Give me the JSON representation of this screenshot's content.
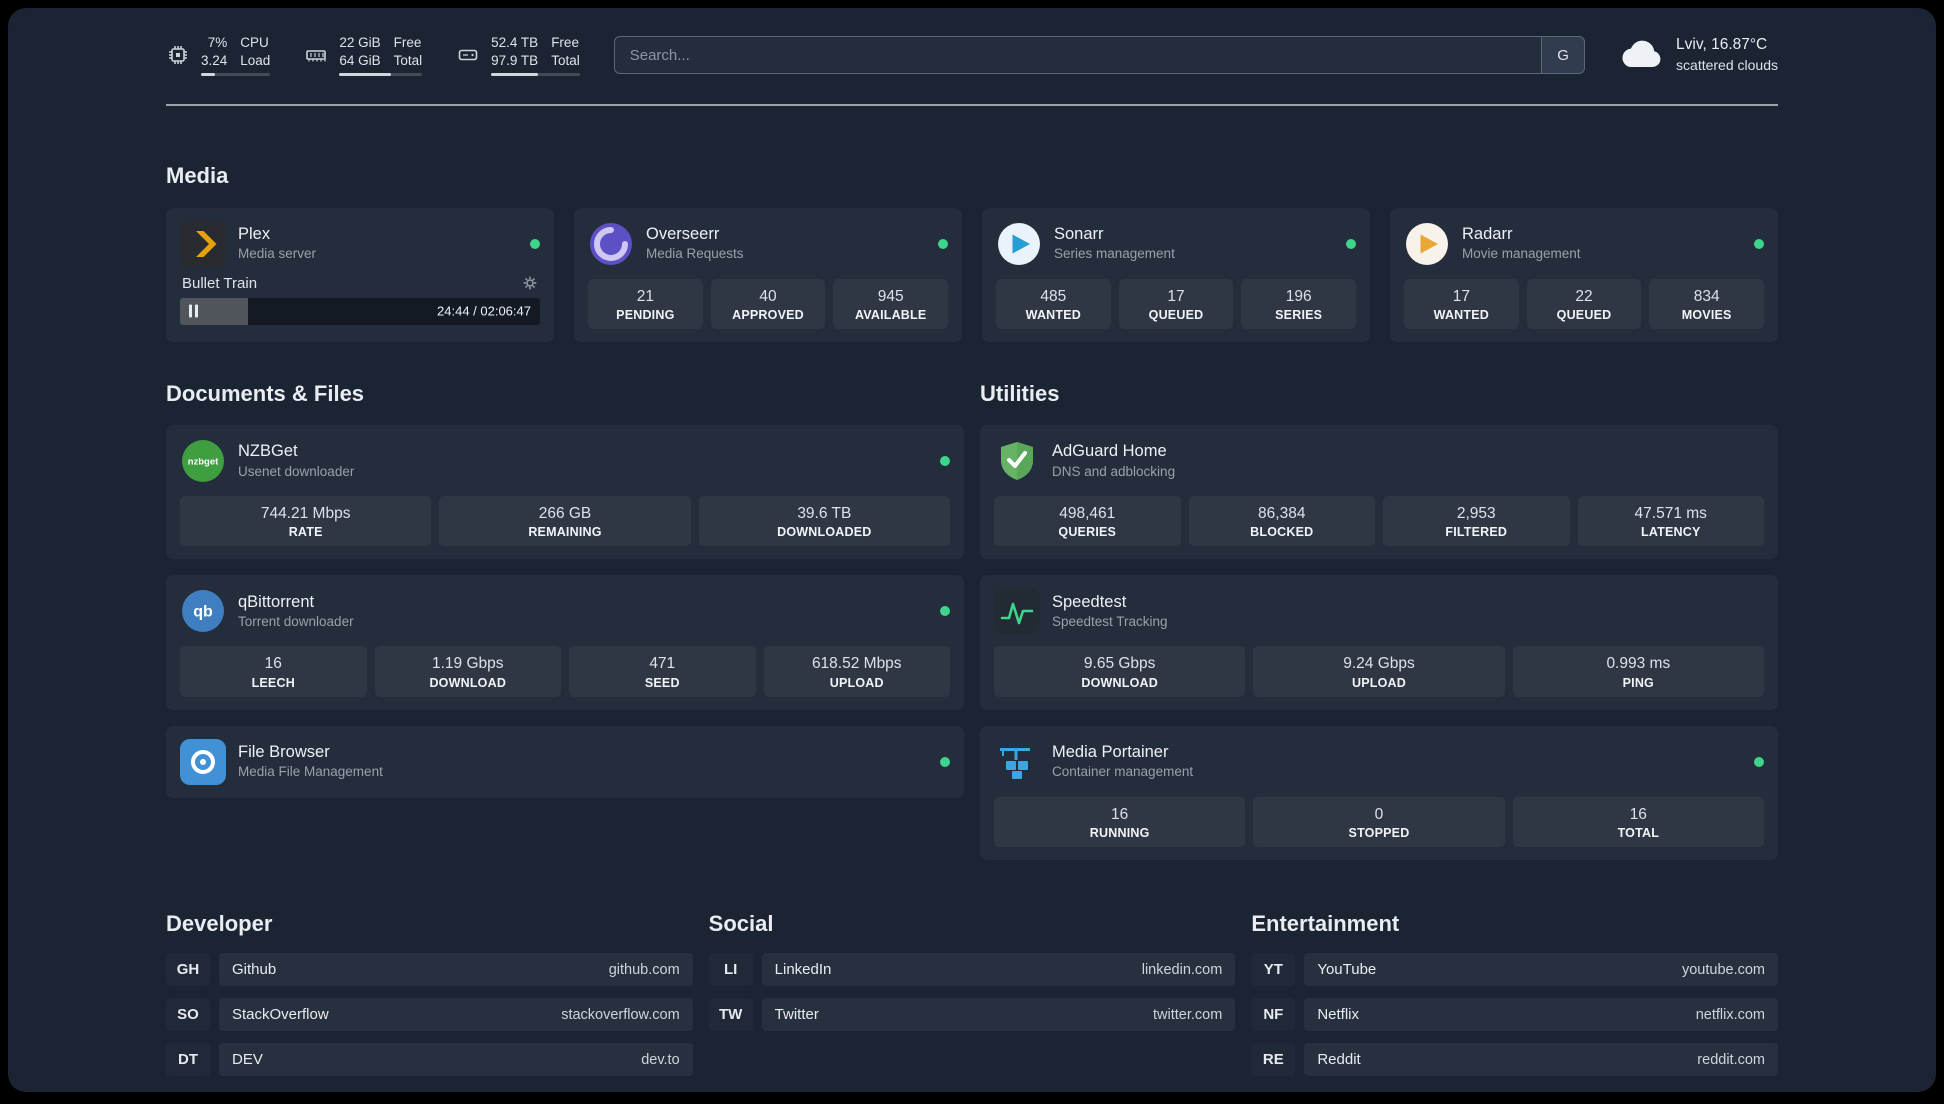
{
  "topbar": {
    "widgets": [
      {
        "icon": "cpu-icon",
        "values": [
          "7%",
          "3.24"
        ],
        "labels": [
          "CPU",
          "Load"
        ],
        "progress": 20
      },
      {
        "icon": "memory-icon",
        "values": [
          "22 GiB",
          "64 GiB"
        ],
        "labels": [
          "Free",
          "Total"
        ],
        "progress": 62
      },
      {
        "icon": "disk-icon",
        "values": [
          "52.4 TB",
          "97.9 TB"
        ],
        "labels": [
          "Free",
          "Total"
        ],
        "progress": 53
      }
    ],
    "search": {
      "placeholder": "Search...",
      "provider_label": "G"
    },
    "weather": {
      "icon": "cloud-icon",
      "location": "Lviv, 16.87°C",
      "condition": "scattered clouds"
    }
  },
  "sections": {
    "media": {
      "title": "Media",
      "services": [
        {
          "name": "Plex",
          "subtitle": "Media server",
          "icon": "plex-icon",
          "status": "online",
          "player": {
            "track": "Bullet Train",
            "time": "24:44 / 02:06:47",
            "progress_percent": 19
          }
        },
        {
          "name": "Overseerr",
          "subtitle": "Media Requests",
          "icon": "overseerr-icon",
          "status": "online",
          "stats": [
            {
              "value": "21",
              "label": "PENDING"
            },
            {
              "value": "40",
              "label": "APPROVED"
            },
            {
              "value": "945",
              "label": "AVAILABLE"
            }
          ]
        },
        {
          "name": "Sonarr",
          "subtitle": "Series management",
          "icon": "sonarr-icon",
          "status": "online",
          "stats": [
            {
              "value": "485",
              "label": "WANTED"
            },
            {
              "value": "17",
              "label": "QUEUED"
            },
            {
              "value": "196",
              "label": "SERIES"
            }
          ]
        },
        {
          "name": "Radarr",
          "subtitle": "Movie management",
          "icon": "radarr-icon",
          "status": "online",
          "stats": [
            {
              "value": "17",
              "label": "WANTED"
            },
            {
              "value": "22",
              "label": "QUEUED"
            },
            {
              "value": "834",
              "label": "MOVIES"
            }
          ]
        }
      ]
    },
    "files": {
      "title": "Documents & Files",
      "services": [
        {
          "name": "NZBGet",
          "subtitle": "Usenet downloader",
          "icon": "nzbget-icon",
          "status": "online",
          "stats": [
            {
              "value": "744.21 Mbps",
              "label": "RATE"
            },
            {
              "value": "266 GB",
              "label": "REMAINING"
            },
            {
              "value": "39.6 TB",
              "label": "DOWNLOADED"
            }
          ]
        },
        {
          "name": "qBittorrent",
          "subtitle": "Torrent downloader",
          "icon": "qbittorrent-icon",
          "status": "online",
          "stats": [
            {
              "value": "16",
              "label": "LEECH"
            },
            {
              "value": "1.19 Gbps",
              "label": "DOWNLOAD"
            },
            {
              "value": "471",
              "label": "SEED"
            },
            {
              "value": "618.52 Mbps",
              "label": "UPLOAD"
            }
          ]
        },
        {
          "name": "File Browser",
          "subtitle": "Media File Management",
          "icon": "filebrowser-icon",
          "status": "online",
          "stats": []
        }
      ]
    },
    "utilities": {
      "title": "Utilities",
      "services": [
        {
          "name": "AdGuard Home",
          "subtitle": "DNS and adblocking",
          "icon": "adguard-icon",
          "stats": [
            {
              "value": "498,461",
              "label": "QUERIES"
            },
            {
              "value": "86,384",
              "label": "BLOCKED"
            },
            {
              "value": "2,953",
              "label": "FILTERED"
            },
            {
              "value": "47.571 ms",
              "label": "LATENCY"
            }
          ]
        },
        {
          "name": "Speedtest",
          "subtitle": "Speedtest Tracking",
          "icon": "speedtest-icon",
          "stats": [
            {
              "value": "9.65 Gbps",
              "label": "DOWNLOAD"
            },
            {
              "value": "9.24 Gbps",
              "label": "UPLOAD"
            },
            {
              "value": "0.993 ms",
              "label": "PING"
            }
          ]
        },
        {
          "name": "Media Portainer",
          "subtitle": "Container management",
          "icon": "portainer-icon",
          "status": "online",
          "stats": [
            {
              "value": "16",
              "label": "RUNNING"
            },
            {
              "value": "0",
              "label": "STOPPED"
            },
            {
              "value": "16",
              "label": "TOTAL"
            }
          ]
        }
      ]
    }
  },
  "bookmarks": [
    {
      "title": "Developer",
      "items": [
        {
          "abbr": "GH",
          "name": "Github",
          "domain": "github.com"
        },
        {
          "abbr": "SO",
          "name": "StackOverflow",
          "domain": "stackoverflow.com"
        },
        {
          "abbr": "DT",
          "name": "DEV",
          "domain": "dev.to"
        }
      ]
    },
    {
      "title": "Social",
      "items": [
        {
          "abbr": "LI",
          "name": "LinkedIn",
          "domain": "linkedin.com"
        },
        {
          "abbr": "TW",
          "name": "Twitter",
          "domain": "twitter.com"
        }
      ]
    },
    {
      "title": "Entertainment",
      "items": [
        {
          "abbr": "YT",
          "name": "YouTube",
          "domain": "youtube.com"
        },
        {
          "abbr": "NF",
          "name": "Netflix",
          "domain": "netflix.com"
        },
        {
          "abbr": "RE",
          "name": "Reddit",
          "domain": "reddit.com"
        }
      ]
    }
  ],
  "colors": {
    "background": "#1b2433",
    "status_online": "#3ed48c",
    "plex_amber": "#e5a00d",
    "overseerr_purple": "#5d50c4",
    "sonarr_blue": "#279ed3",
    "radarr_amber": "#e9a835",
    "nzbget_green": "#3f9e3f",
    "qbittorrent_blue": "#3f7fc1",
    "adguard_green": "#67b267",
    "speedtest_green": "#3ed48c",
    "filebrowser_blue": "#4191d6",
    "portainer_blue": "#3aa7e0"
  }
}
